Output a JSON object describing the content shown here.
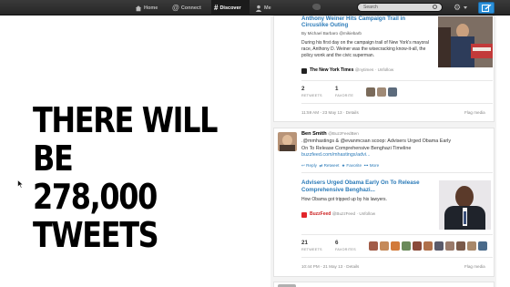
{
  "nav": {
    "home": "Home",
    "connect": "Connect",
    "discover": "Discover",
    "me": "Me",
    "search_placeholder": "Search"
  },
  "headline": {
    "line1": "THERE WILL BE",
    "line2": "278,000 TWEETS"
  },
  "tweet1": {
    "title_line1": "Anthony Weiner Hits Campaign Trail in",
    "title_line2": "Circuslike Outing",
    "byline": "By Michael Barbaro @mikiebarb",
    "body": "During his first day on the campaign trail of New York's mayoral race, Anthony D. Weiner was the wisecracking know-it-all, the policy wonk and the civic superman.",
    "source_name": "The New York Times",
    "source_handle": "@nytimes",
    "source_action": "Unfollow",
    "retweets": "2",
    "retweets_label": "RETWEETS",
    "favorites": "1",
    "favorites_label": "FAVORITE",
    "timestamp": "11:59 AM - 23 May 13",
    "details": "Details",
    "flag": "Flag media"
  },
  "tweet2": {
    "author": "Ben Smith",
    "handle": "@BuzzFeedBen",
    "body_line1": ".@mmhastings & @evanmcsan scoop: Advisers Urged Obama Early",
    "body_line2": "On To Release Comprehensive Benghazi Timeline",
    "body_line3": "buzzfeed.com/mhastings/advi...",
    "actions": {
      "reply": "Reply",
      "retweet": "Retweet",
      "favorite": "Favorite",
      "more": "More"
    },
    "card_title_line1": "Advisers Urged Obama Early On To Release",
    "card_title_line2": "Comprehensive Benghazi...",
    "card_body": "How Obama got tripped up by his lawyers.",
    "source_name": "BuzzFeed",
    "source_handle": "@BuzzFeed",
    "source_action": "Unfollow",
    "retweets": "21",
    "retweets_label": "RETWEETS",
    "favorites": "6",
    "favorites_label": "FAVORITES",
    "timestamp": "10:44 PM - 21 May 13",
    "details": "Details",
    "flag": "Flag media"
  },
  "colors": {
    "accent": "#2a7ab8",
    "topbar": "#2e2e2e",
    "compose": "#2a8fd8"
  }
}
